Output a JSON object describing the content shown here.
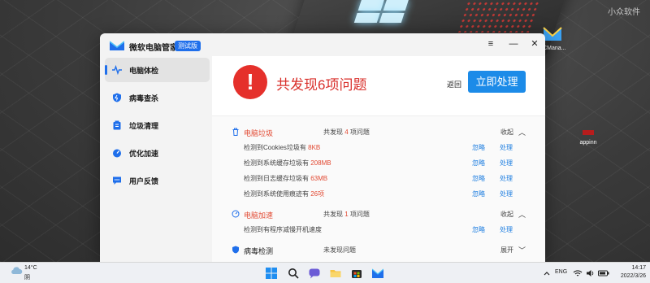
{
  "desktop": {
    "watermark": "小众软件",
    "icons": [
      {
        "label": "PCMana...",
        "name": "pc-manager-shortcut"
      },
      {
        "label": "appinn",
        "name": "appinn-shortcut"
      }
    ]
  },
  "app": {
    "name": "微软电脑管家",
    "badge": "测试版",
    "window_controls": [
      "≡",
      "—",
      "✕"
    ]
  },
  "sidebar": {
    "items": [
      {
        "label": "电脑体检",
        "icon": "pulse-icon",
        "active": true
      },
      {
        "label": "病毒查杀",
        "icon": "shield-icon",
        "active": false
      },
      {
        "label": "垃圾清理",
        "icon": "cleanup-icon",
        "active": false
      },
      {
        "label": "优化加速",
        "icon": "speedometer-icon",
        "active": false
      },
      {
        "label": "用户反馈",
        "icon": "feedback-icon",
        "active": false
      }
    ]
  },
  "summary": {
    "alert_symbol": "!",
    "title": "共发现6项问题",
    "back_label": "返回",
    "fix_label": "立即处理"
  },
  "sections": [
    {
      "title": "电脑垃圾",
      "count_prefix": "共发现 ",
      "count_num": "4",
      "count_suffix": " 项问题",
      "toggle": "收起",
      "chevron": "︿",
      "highlight": true,
      "rows": [
        {
          "text": "检测到Cookies垃圾有 ",
          "value": "8KB",
          "ignore": "忽略",
          "handle": "处理"
        },
        {
          "text": "检测到系统缓存垃圾有 ",
          "value": "208MB",
          "ignore": "忽略",
          "handle": "处理"
        },
        {
          "text": "检测到日志缓存垃圾有 ",
          "value": "63MB",
          "ignore": "忽略",
          "handle": "处理"
        },
        {
          "text": "检测到系统使用痕迹有 ",
          "value": "26项",
          "ignore": "忽略",
          "handle": "处理"
        }
      ]
    },
    {
      "title": "电脑加速",
      "count_prefix": "共发现 ",
      "count_num": "1",
      "count_suffix": " 项问题",
      "toggle": "收起",
      "chevron": "︿",
      "highlight": true,
      "rows": [
        {
          "text": "检测到有程序减慢开机速度",
          "value": "",
          "ignore": "忽略",
          "handle": "处理"
        }
      ]
    },
    {
      "title": "病毒检测",
      "count_prefix": "未发现问题",
      "count_num": "",
      "count_suffix": "",
      "toggle": "展开",
      "chevron": "﹀",
      "highlight": false,
      "rows": []
    }
  ],
  "taskbar": {
    "weather_temp": "14°C",
    "weather_cond": "阴",
    "lang": "ENG",
    "time": "14:17",
    "date": "2022/3/26",
    "apps": [
      "windows-start-icon",
      "search-icon",
      "chat-icon",
      "file-explorer-icon",
      "store-icon",
      "pc-manager-icon"
    ]
  }
}
